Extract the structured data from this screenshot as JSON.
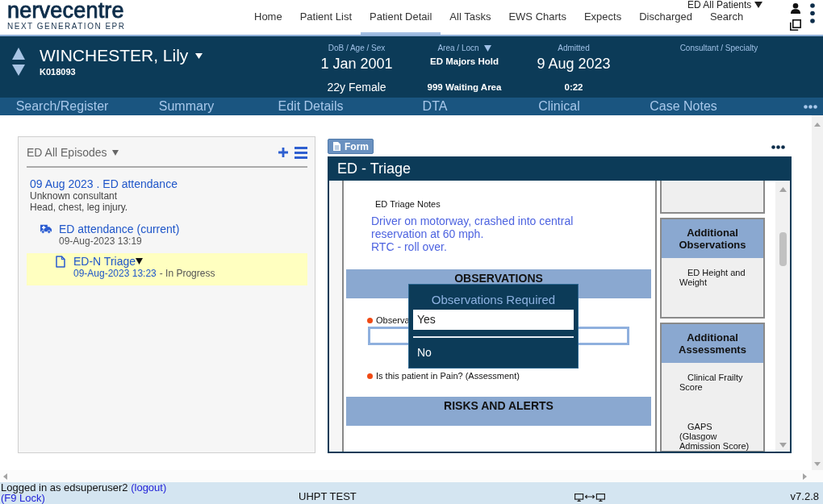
{
  "header": {
    "logo": "nervecentre",
    "tagline": "NEXT GENERATION EPR",
    "nav": [
      {
        "label": "Home",
        "selected": false
      },
      {
        "label": "Patient List",
        "selected": false
      },
      {
        "label": "Patient Detail",
        "selected": true
      },
      {
        "label": "All Tasks",
        "selected": false
      },
      {
        "label": "EWS Charts",
        "selected": false
      },
      {
        "label": "Expects",
        "selected": false
      },
      {
        "label": "Discharged",
        "selected": false
      },
      {
        "label": "Search",
        "selected": false
      }
    ],
    "patient_list": "ED All Patients"
  },
  "patient": {
    "name": "WINCHESTER, Lily",
    "id": "K018093",
    "fields": [
      {
        "kind": "large",
        "label": "DoB / Age / Sex",
        "has_menu": false,
        "value": "1 Jan 2001",
        "detail": "22y Female"
      },
      {
        "kind": "compact",
        "label": "Area / Locn",
        "has_menu": true,
        "value": "ED Majors Hold",
        "detail": "999 Waiting Area"
      },
      {
        "kind": "mixed",
        "label": "Admitted",
        "has_menu": false,
        "value": "9 Aug 2023",
        "detail": "0:22"
      },
      {
        "kind": "heading",
        "label": "Consultant / Specialty",
        "has_menu": false
      }
    ]
  },
  "tabs": [
    "Search/Register",
    "Summary",
    "Edit Details",
    "DTA",
    "Clinical",
    "Case Notes"
  ],
  "episodes_panel": {
    "title": "ED All Episodes",
    "episodes": [
      {
        "title": "09 Aug 2023 . ED attendance",
        "consultant": "Unknown consultant",
        "complaint": "Head, chest, leg injury.",
        "children": [
          {
            "kind": "attendance",
            "title": "ED attendance (current)",
            "time": "09-Aug-2023 13:19",
            "selected": false,
            "children": [
              {
                "kind": "form",
                "title": "ED-N Triage",
                "time": "09-Aug-2023 13:23",
                "status": "- In Progress",
                "selected": true
              }
            ]
          }
        ]
      }
    ]
  },
  "form": {
    "button": "Form",
    "title": "ED - Triage",
    "items": [
      {
        "kind": "note",
        "label": "ED Triage Notes",
        "lines": [
          "Driver on motorway, crashed into central reservation at 60 mph.",
          "RTC - roll over."
        ]
      },
      {
        "kind": "section",
        "title": "OBSERVATIONS"
      },
      {
        "kind": "field",
        "label": "Observa",
        "required": true
      },
      {
        "kind": "question",
        "label": "Is this patient in Pain? (Assessment)",
        "required": true
      },
      {
        "kind": "section",
        "title": "RISKS AND ALERTS"
      }
    ],
    "side_boxes": [
      {
        "kind": "clipped"
      },
      {
        "kind": "group",
        "title": "Additional Observations",
        "links": [
          "ED Height and Weight"
        ]
      },
      {
        "kind": "group",
        "title": "Additional Assessments",
        "links": [
          "Clinical Frailty Score",
          "GAPS (Glasgow Admission Score)"
        ]
      }
    ],
    "popup": {
      "title": "Observations Required",
      "options": [
        {
          "label": "Yes",
          "selected": true
        },
        {
          "label": "No",
          "selected": false
        }
      ]
    }
  },
  "status_bar": {
    "login": "Logged in as edsuperuser2",
    "logout": "(logout)",
    "lock": "(F9 Lock)",
    "environment": "UHPT TEST",
    "version": "v7.2.8"
  }
}
